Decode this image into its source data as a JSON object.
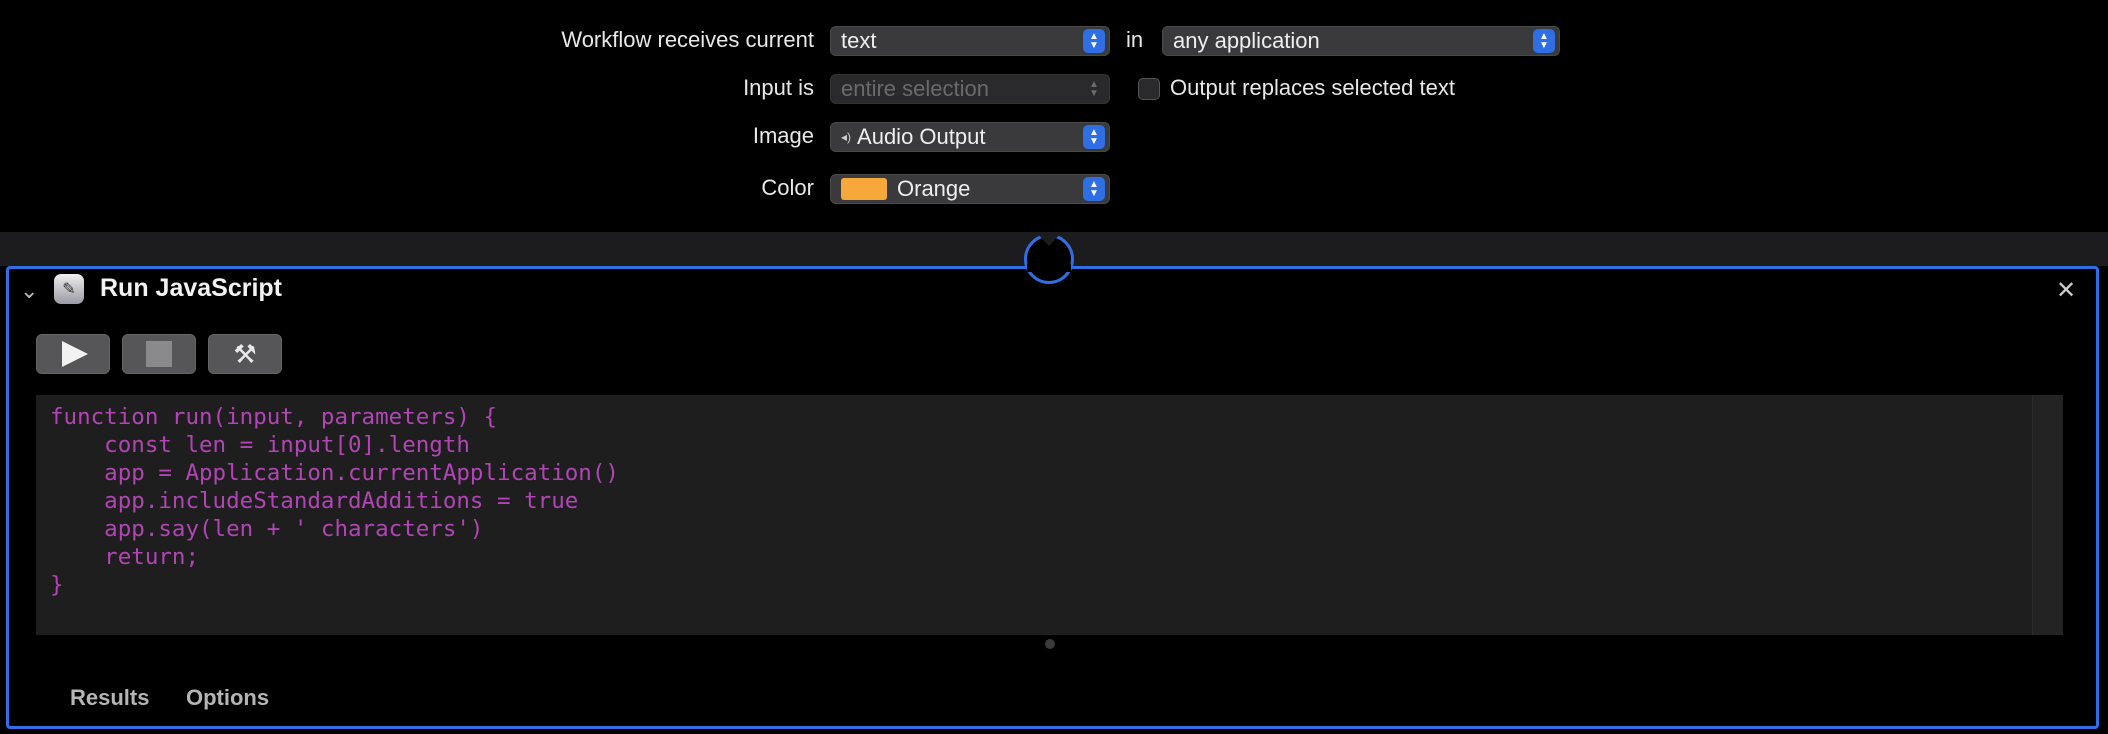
{
  "workflow": {
    "receives_label": "Workflow receives current",
    "receives_value": "text",
    "in_label": "in",
    "application_value": "any application",
    "input_label": "Input is",
    "input_value": "entire selection",
    "output_replaces_label": "Output replaces selected text",
    "output_replaces_checked": false,
    "image_label": "Image",
    "image_value": "Audio Output",
    "color_label": "Color",
    "color_value": "Orange",
    "color_swatch": "#f6a93a"
  },
  "action": {
    "title": "Run JavaScript",
    "icon": "script-editor-icon",
    "code": "function run(input, parameters) {\n    const len = input[0].length\n    app = Application.currentApplication()\n    app.includeStandardAdditions = true\n    app.say(len + ' characters')\n    return;\n}",
    "tabs": [
      "Results",
      "Options"
    ]
  },
  "colors": {
    "accent": "#2f6fe3",
    "code_text": "#b244b6"
  }
}
